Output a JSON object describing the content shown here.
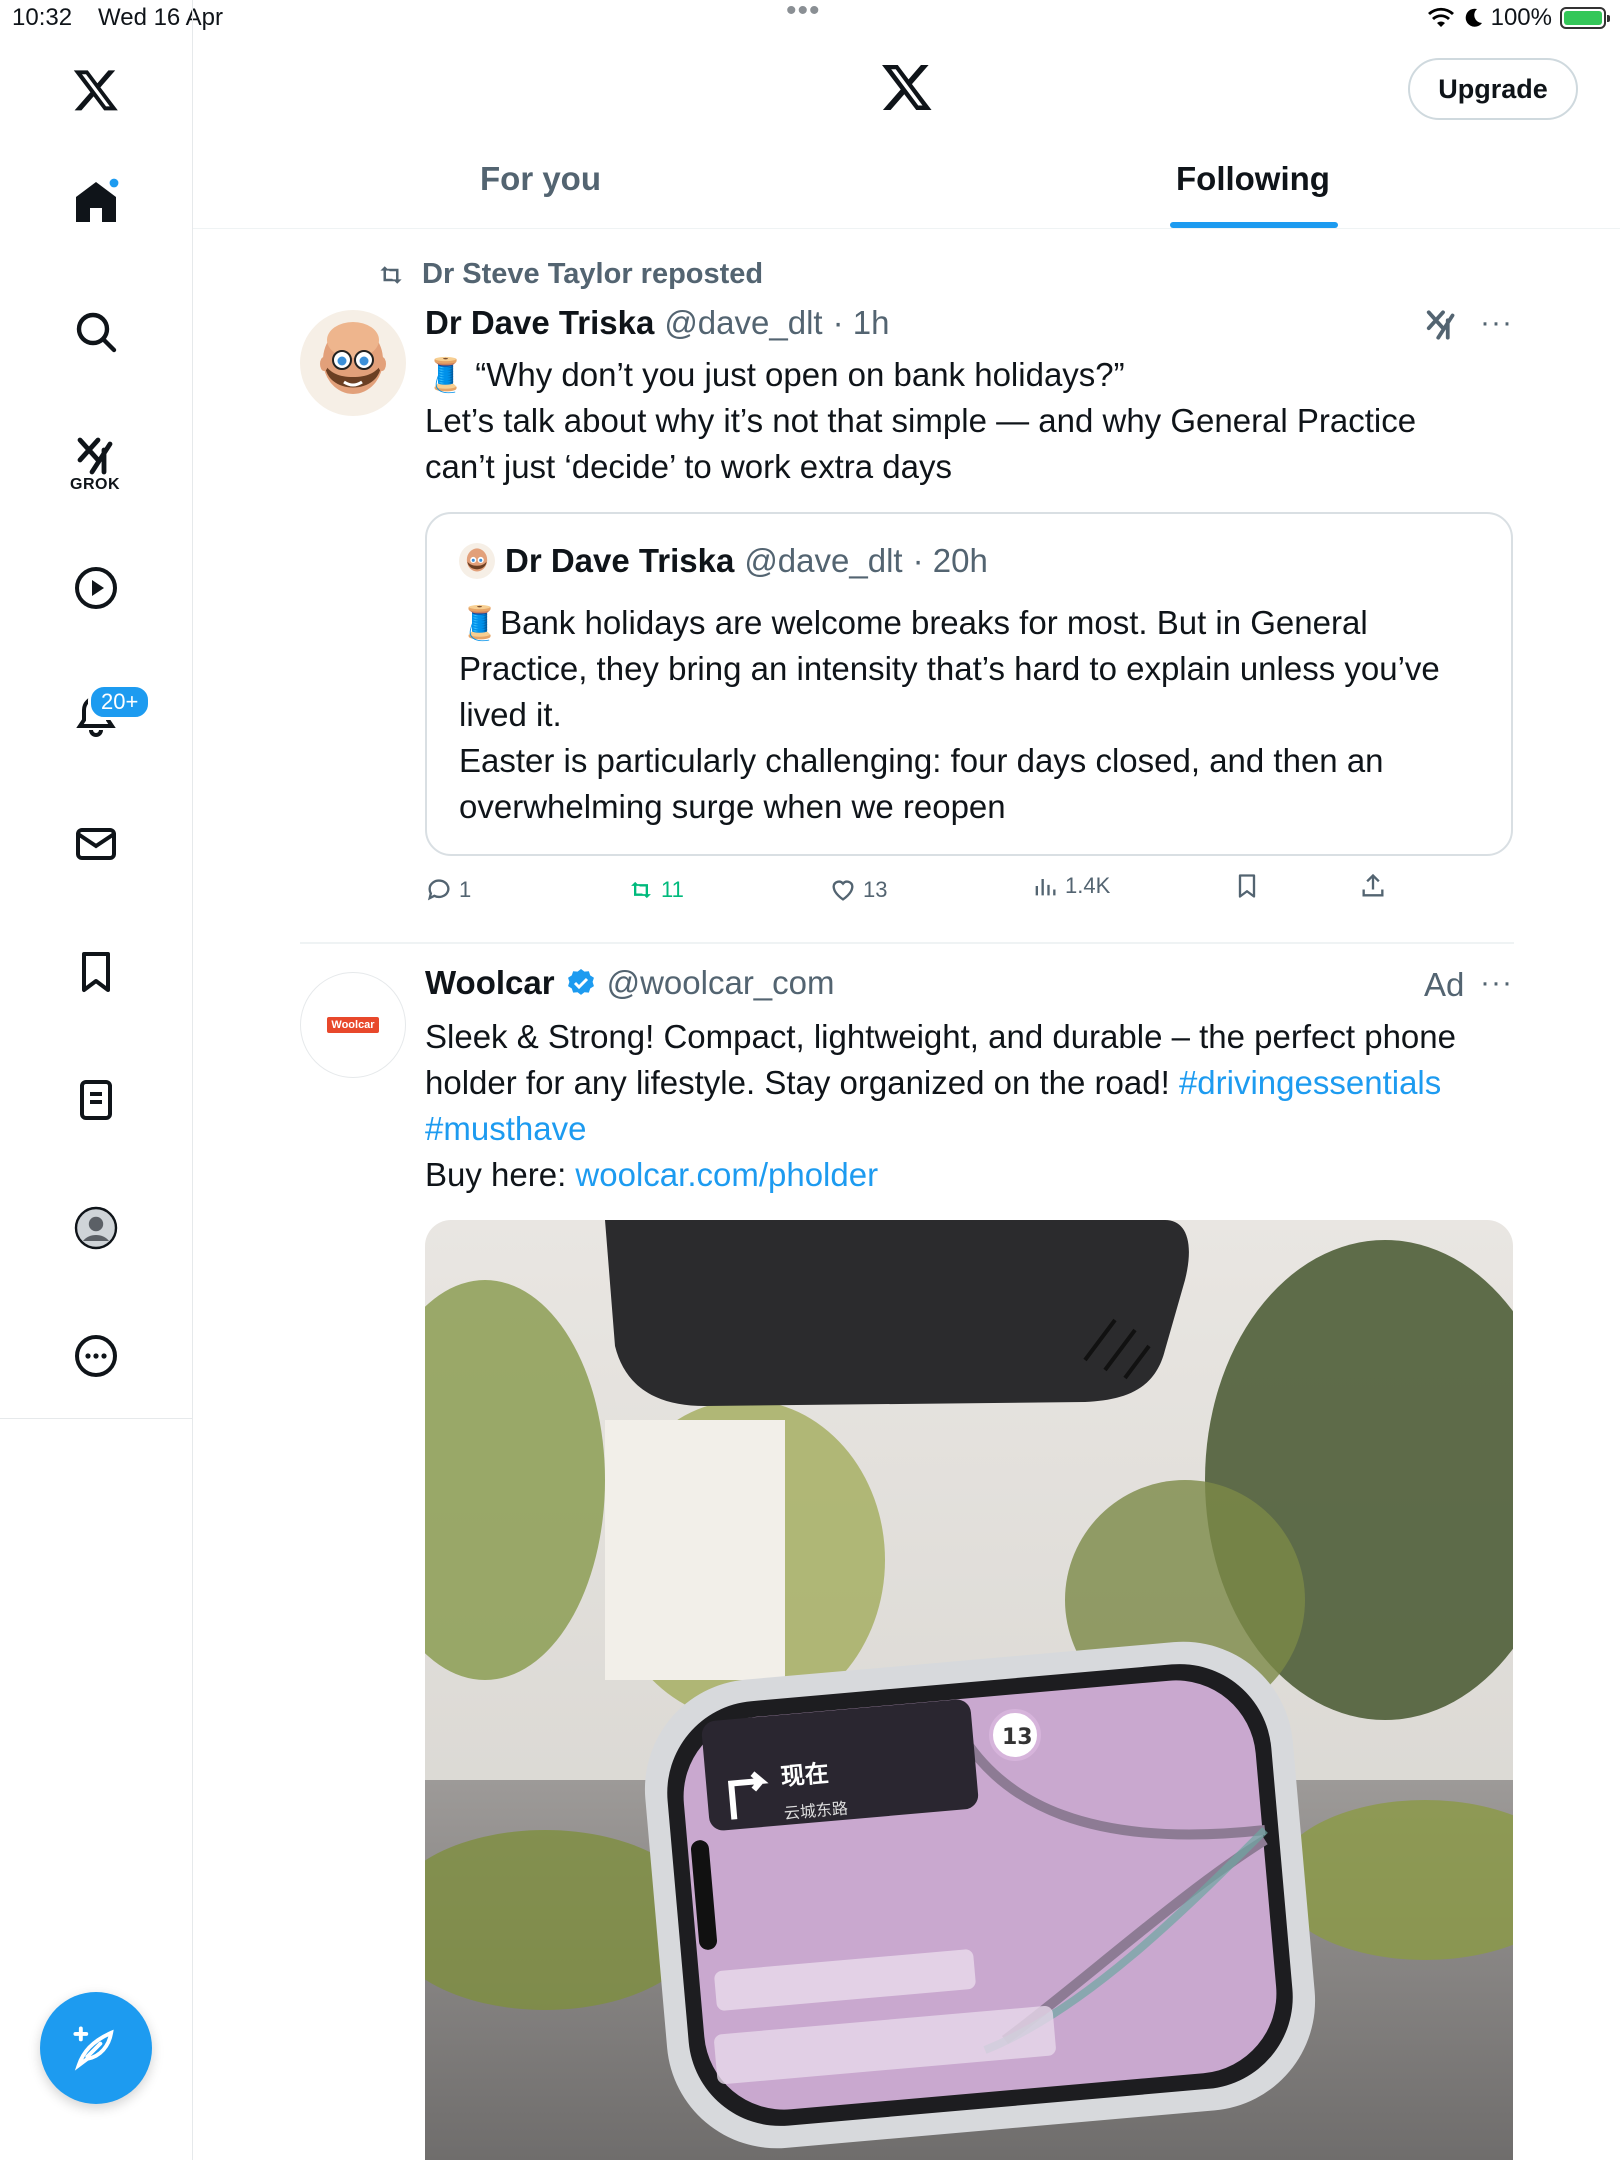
{
  "status": {
    "time": "10:32",
    "date": "Wed 16 Apr",
    "battery": "100%"
  },
  "header": {
    "upgrade_label": "Upgrade"
  },
  "tabs": [
    {
      "label": "For you"
    },
    {
      "label": "Following"
    }
  ],
  "sidebar": {
    "notifications_badge": "20+",
    "grok_label": "GROK"
  },
  "post1": {
    "repost_label": "Dr Steve Taylor reposted",
    "author": "Dr Dave Triska",
    "handle": "@dave_dlt",
    "time": "· 1h",
    "line1": "🧵 “Why don’t you just open on bank holidays?”",
    "line2": "Let’s talk about why it’s not that simple — and why General Practice",
    "line3": "can’t just ‘decide’ to work extra days",
    "quote": {
      "author": "Dr Dave Triska",
      "handle": "@dave_dlt",
      "time": "· 20h",
      "line1": "🧵Bank holidays are welcome breaks for most. But in General",
      "line2": "Practice, they bring an intensity that’s hard to explain unless you’ve",
      "line3": "lived it.",
      "line4": "Easter is particularly challenging: four days closed, and then an",
      "line5": "overwhelming surge when we reopen"
    },
    "stats": {
      "replies": "1",
      "reposts": "11",
      "likes": "13",
      "views": "1.4K"
    }
  },
  "ad": {
    "author": "Woolcar",
    "handle": "@woolcar_com",
    "label": "Ad",
    "logo_text": "Woolcar",
    "line1": "Sleek & Strong! Compact, lightweight, and durable – the perfect phone",
    "line2_text": "holder for any lifestyle. Stay organized on the road! ",
    "hashtag1": "#drivingessentials",
    "hashtag2": "#musthave",
    "buy_prefix": "Buy here: ",
    "buy_link": "woolcar.com/pholder",
    "media": {
      "nav_text": "现在",
      "nav_sub": "云城东路",
      "speed": "13"
    }
  },
  "colors": {
    "accent": "#1d9bf0",
    "repost_green": "#00ba7c",
    "muted": "#536471"
  }
}
